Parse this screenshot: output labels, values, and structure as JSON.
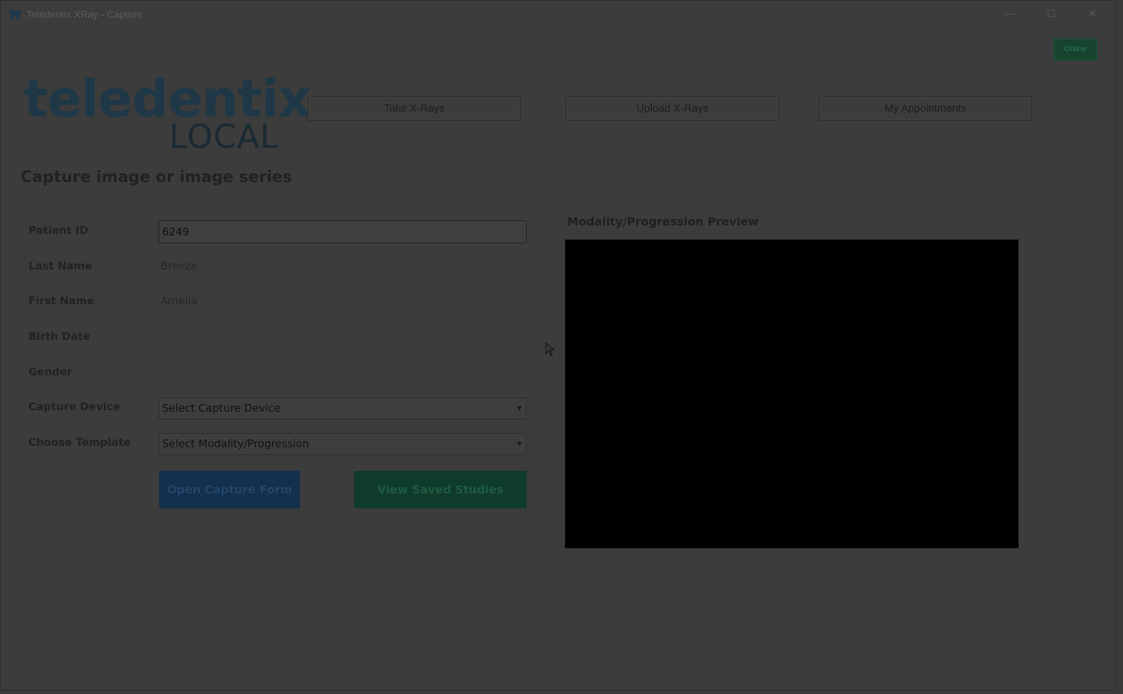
{
  "window": {
    "title": "Teledentix XRay - Capture",
    "controls": {
      "minimize": "—",
      "maximize": "☐",
      "close": "✕"
    }
  },
  "status": {
    "online_label": "Online",
    "color": "#17442e"
  },
  "logo": {
    "line1": "teledentix",
    "line2": "LOCAL"
  },
  "nav": {
    "take_xrays": "Take X-Rays",
    "upload_xrays": "Upload X-Rays",
    "my_appointments": "My Appointments"
  },
  "page": {
    "title": "Capture image or image series"
  },
  "form": {
    "patient_id": {
      "label": "Patient ID",
      "value": "6249"
    },
    "last_name": {
      "label": "Last Name",
      "value": "Breeze"
    },
    "first_name": {
      "label": "First Name",
      "value": "Amelia"
    },
    "birth_date": {
      "label": "Birth Date",
      "value": ""
    },
    "gender": {
      "label": "Gender",
      "value": ""
    },
    "capture_device": {
      "label": "Capture Device",
      "selected": "Select Capture Device"
    },
    "choose_template": {
      "label": "Choose Template",
      "selected": "Select Modality/Progression"
    }
  },
  "actions": {
    "open_capture_form": "Open Capture Form",
    "view_saved_studies": "View Saved Studies",
    "capture_color": "#13304c",
    "saved_color": "#0f3b2b"
  },
  "preview": {
    "label": "Modality/Progression Preview"
  },
  "icons": {
    "app": "tooth-icon",
    "chevron": "▾"
  }
}
